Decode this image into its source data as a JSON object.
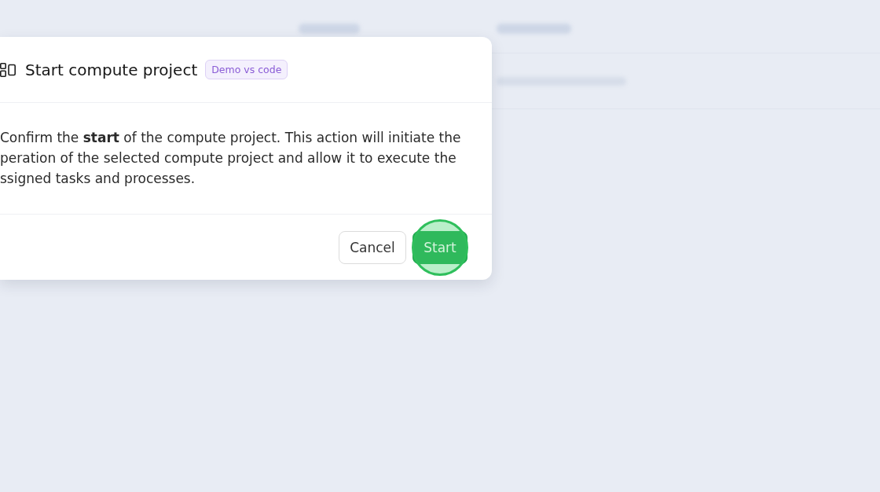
{
  "dialog": {
    "title": "Start compute project",
    "badge": "Demo vs code",
    "body_lines": [
      "Confirm the **start** of the compute project. This action will initiate the",
      "peration of the selected compute project and allow it to execute the",
      "ssigned tasks and processes."
    ],
    "buttons": [
      {
        "label": "Cancel",
        "kind": "secondary",
        "highlighted": false
      },
      {
        "label": "Start",
        "kind": "primary",
        "highlighted": true
      }
    ]
  }
}
